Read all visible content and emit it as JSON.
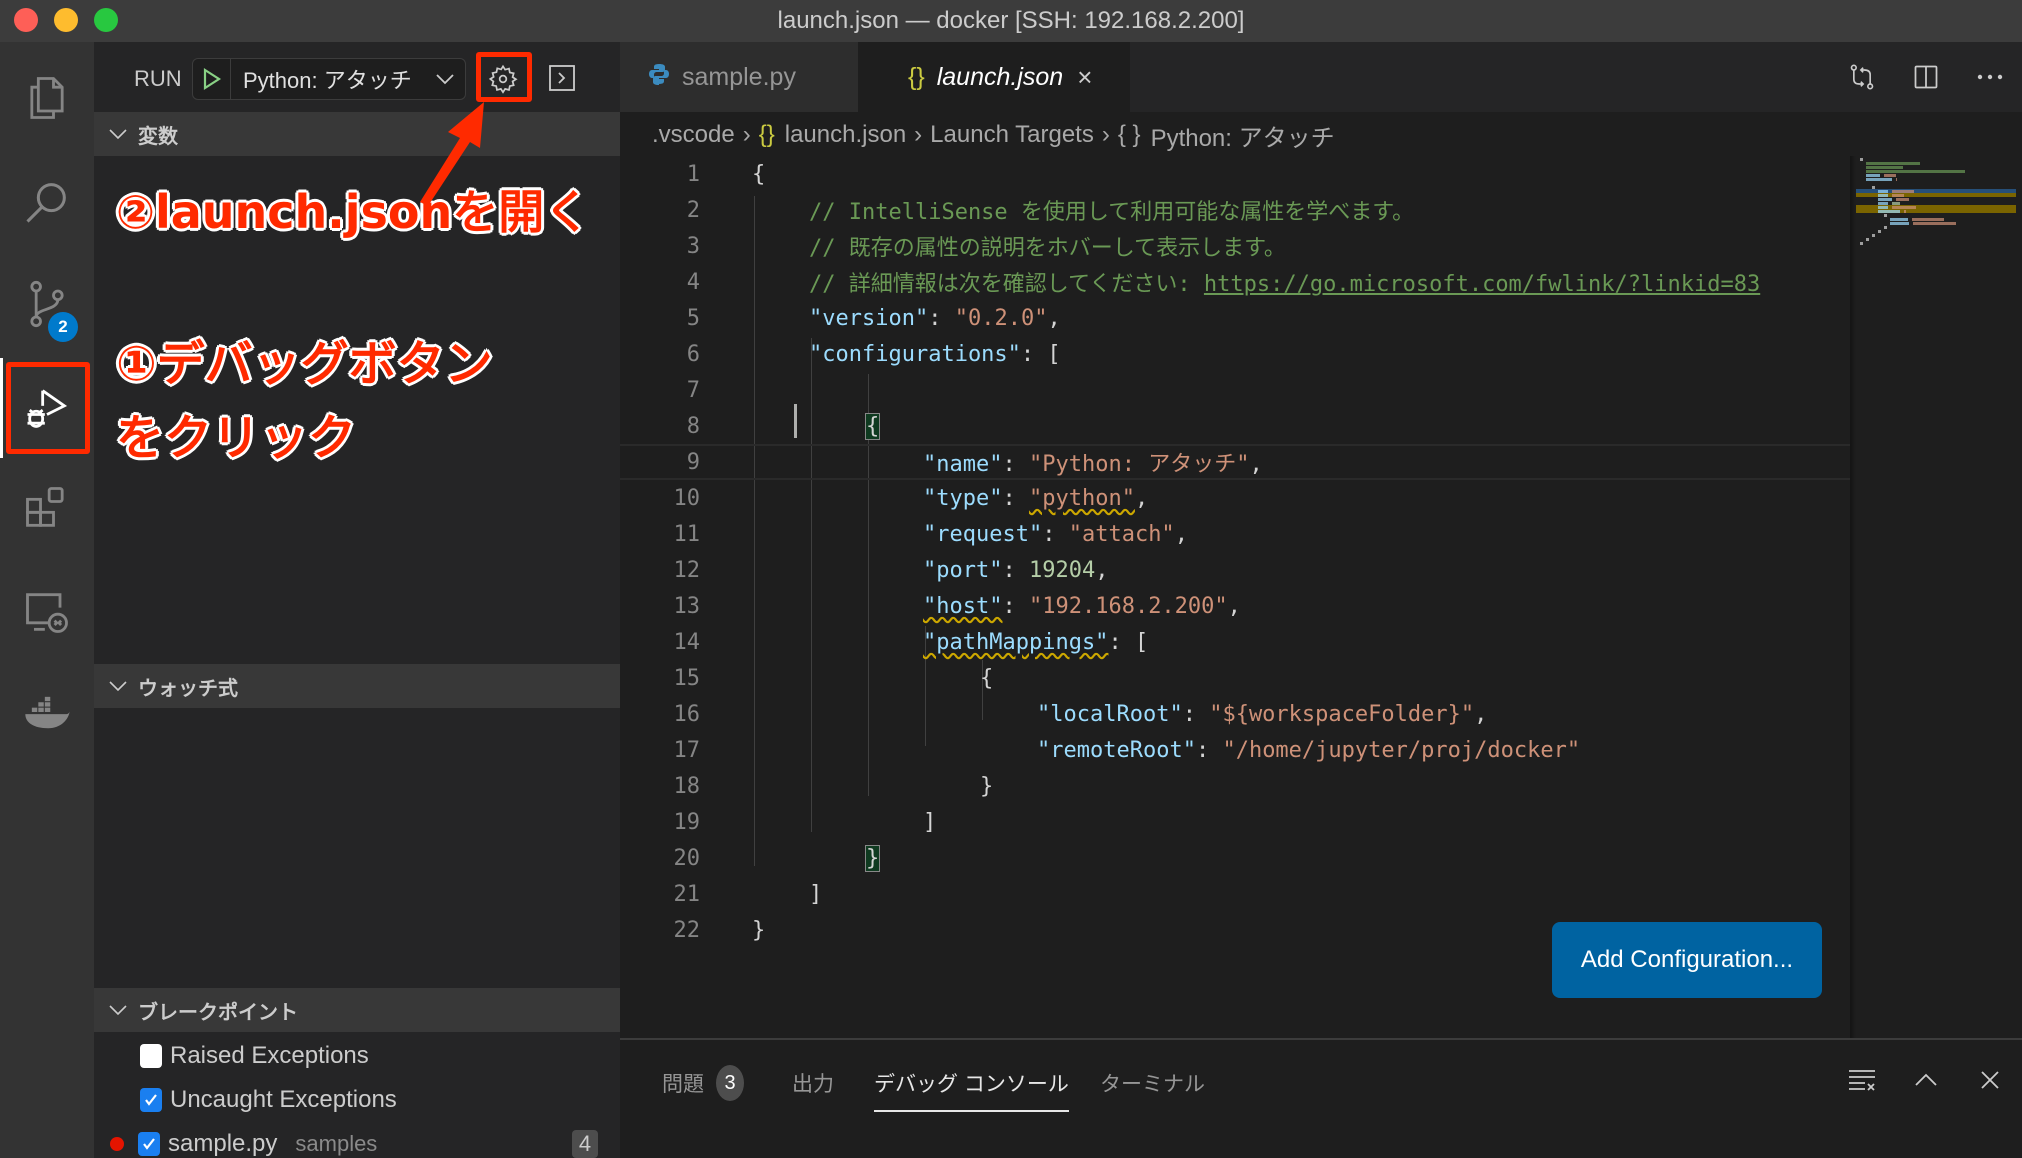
{
  "window": {
    "title": "launch.json — docker [SSH: 192.168.2.200]"
  },
  "activity_bar": {
    "items": [
      {
        "name": "explorer",
        "icon": "files-icon"
      },
      {
        "name": "search",
        "icon": "search-icon"
      },
      {
        "name": "source-control",
        "icon": "source-control-icon",
        "badge": "2"
      },
      {
        "name": "run-debug",
        "icon": "debug-icon",
        "active": true
      },
      {
        "name": "extensions",
        "icon": "extensions-icon"
      },
      {
        "name": "remote-explorer",
        "icon": "remote-explorer-icon"
      },
      {
        "name": "docker",
        "icon": "docker-icon"
      }
    ]
  },
  "sidebar": {
    "run_label": "RUN",
    "selected_config": "Python: アタッチ",
    "sections": {
      "variables": "変数",
      "watch": "ウォッチ式",
      "breakpoints": "ブレークポイント"
    },
    "breakpoints": [
      {
        "label": "Raised Exceptions",
        "checked": false
      },
      {
        "label": "Uncaught Exceptions",
        "checked": true
      },
      {
        "label": "sample.py",
        "path": "samples",
        "count": "4",
        "checked": true,
        "dot": true
      }
    ]
  },
  "annotations": {
    "step2": "②launch.jsonを開く",
    "step1_line1": "①デバッグボタン",
    "step1_line2": "をクリック",
    "highlight_color": "#ff2a00"
  },
  "editor": {
    "tabs": [
      {
        "label": "sample.py",
        "icon": "python-icon",
        "active": false
      },
      {
        "label": "launch.json",
        "icon": "json-icon",
        "active": true
      }
    ],
    "breadcrumb": [
      ".vscode",
      "launch.json",
      "Launch Targets",
      "Python: アタッチ"
    ],
    "lines": [
      {
        "n": "1",
        "text": "{"
      },
      {
        "n": "2",
        "text": "// IntelliSense を使用して利用可能な属性を学べます。"
      },
      {
        "n": "3",
        "text": "// 既存の属性の説明をホバーして表示します。"
      },
      {
        "n": "4",
        "text": "// 詳細情報は次を確認してください: ",
        "link": "https://go.microsoft.com/fwlink/?linkid=83"
      },
      {
        "n": "5",
        "key": "\"version\"",
        "value": "\"0.2.0\""
      },
      {
        "n": "6",
        "key": "\"configurations\"",
        "value": "["
      },
      {
        "n": "7",
        "text": ""
      },
      {
        "n": "8",
        "text": "{"
      },
      {
        "n": "9",
        "key": "\"name\"",
        "value": "\"Python: アタッチ\""
      },
      {
        "n": "10",
        "key": "\"type\"",
        "value": "\"python\""
      },
      {
        "n": "11",
        "key": "\"request\"",
        "value": "\"attach\""
      },
      {
        "n": "12",
        "key": "\"port\"",
        "value": "19204"
      },
      {
        "n": "13",
        "key": "\"host\"",
        "value": "\"192.168.2.200\""
      },
      {
        "n": "14",
        "key": "\"pathMappings\"",
        "value": "["
      },
      {
        "n": "15",
        "text": "{"
      },
      {
        "n": "16",
        "key": "\"localRoot\"",
        "value": "\"${workspaceFolder}\""
      },
      {
        "n": "17",
        "key": "\"remoteRoot\"",
        "value": "\"/home/jupyter/proj/docker\""
      },
      {
        "n": "18",
        "text": "}"
      },
      {
        "n": "19",
        "text": "]"
      },
      {
        "n": "20",
        "text": "}"
      },
      {
        "n": "21",
        "text": "]"
      },
      {
        "n": "22",
        "text": "}"
      }
    ],
    "add_config_label": "Add Configuration..."
  },
  "panel": {
    "tabs": [
      {
        "label": "問題",
        "badge": "3"
      },
      {
        "label": "出力"
      },
      {
        "label": "デバッグ コンソール",
        "active": true
      },
      {
        "label": "ターミナル"
      }
    ]
  },
  "colors": {
    "accent": "#007acc",
    "button": "#0063a1",
    "string": "#ce9178",
    "key": "#9cdcfe",
    "comment": "#6a9955",
    "number": "#b5cea8"
  }
}
